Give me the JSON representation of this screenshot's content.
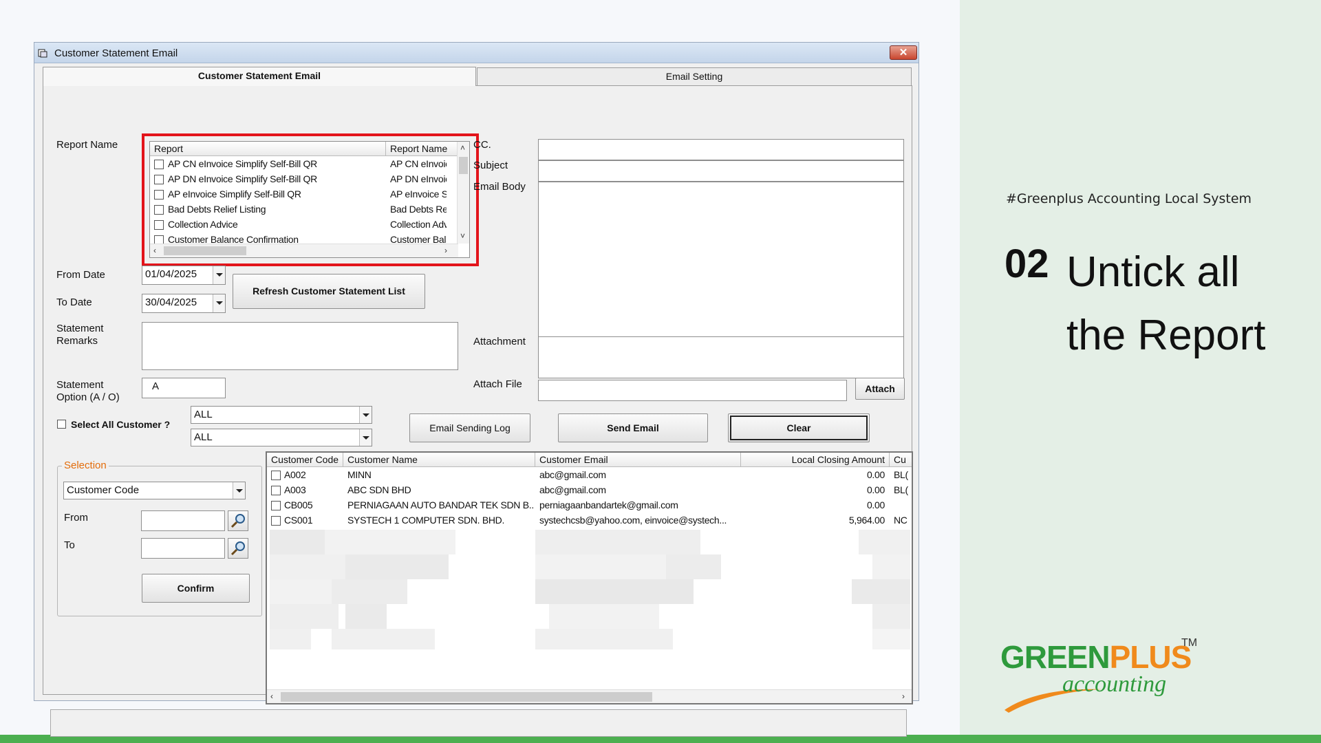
{
  "slide": {
    "hashtag": "#Greenplus Accounting Local System",
    "step_number": "02",
    "step_title": "Untick all the Report",
    "logo": {
      "word1": "GREEN",
      "word2": "PLUS",
      "tm": "TM",
      "sub": "accounting"
    }
  },
  "window": {
    "title": "Customer Statement Email",
    "close_label": "✕",
    "tabs": [
      "Customer Statement Email",
      "Email Setting"
    ]
  },
  "form": {
    "report_name_label": "Report Name",
    "report_list": {
      "headers": [
        "Report",
        "Report Name"
      ],
      "rows": [
        {
          "report": "AP CN eInvoice Simplify Self-Bill QR",
          "name": "AP CN eInvoic"
        },
        {
          "report": "AP DN eInvoice Simplify Self-Bill QR",
          "name": "AP DN eInvoic"
        },
        {
          "report": "AP eInvoice Simplify Self-Bill QR",
          "name": "AP eInvoice S"
        },
        {
          "report": "Bad Debts Relief Listing",
          "name": "Bad Debts Re"
        },
        {
          "report": "Collection Advice",
          "name": "Collection Adv"
        },
        {
          "report": "Customer Balance Confirmation",
          "name": "Customer Bala"
        }
      ]
    },
    "from_date_label": "From Date",
    "from_date": "01/04/2025",
    "to_date_label": "To Date",
    "to_date": "30/04/2025",
    "refresh_button": "Refresh Customer Statement List",
    "remarks_label_1": "Statement",
    "remarks_label_2": "Remarks",
    "option_label_1": "Statement",
    "option_label_2": "Option (A / O)",
    "option_value": "A",
    "select_all_label": "Select All Customer ?",
    "filter_1": "ALL",
    "filter_2": "ALL",
    "selection": {
      "legend": "Selection",
      "field": "Customer Code",
      "from_label": "From",
      "to_label": "To",
      "confirm_button": "Confirm"
    }
  },
  "email": {
    "cc_label": "CC.",
    "subject_label": "Subject",
    "body_label": "Email Body",
    "attachment_label": "Attachment",
    "attach_file_label": "Attach File",
    "attach_button": "Attach",
    "log_button": "Email Sending Log",
    "send_button": "Send Email",
    "clear_button": "Clear"
  },
  "customers": {
    "headers": [
      "Customer Code",
      "Customer Name",
      "Customer Email",
      "Local Closing Amount",
      "Cu"
    ],
    "rows": [
      {
        "code": "A002",
        "name": "MINN",
        "email": "abc@gmail.com",
        "amount": "0.00",
        "cu": "BL("
      },
      {
        "code": "A003",
        "name": "ABC SDN BHD",
        "email": "abc@gmail.com",
        "amount": "0.00",
        "cu": "BL("
      },
      {
        "code": "CB005",
        "name": "PERNIAGAAN AUTO BANDAR TEK SDN B...",
        "email": "perniagaanbandartek@gmail.com",
        "amount": "0.00",
        "cu": ""
      },
      {
        "code": "CS001",
        "name": "SYSTECH 1 COMPUTER SDN. BHD.",
        "email": "systechcsb@yahoo.com, einvoice@systech...",
        "amount": "5,964.00",
        "cu": "NC"
      }
    ]
  },
  "colors": {
    "highlight": "#e3141b",
    "brand_green": "#2e9a3c",
    "brand_orange": "#f08a1c",
    "accent_bar": "#4caf50"
  }
}
